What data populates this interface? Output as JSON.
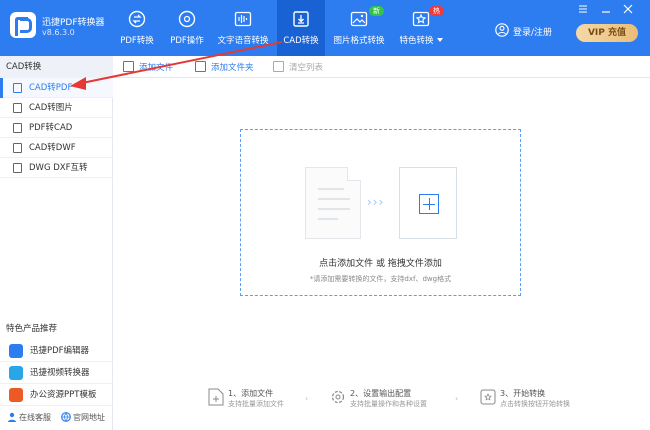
{
  "app": {
    "name": "迅捷PDF转换器",
    "version": "v8.6.3.0"
  },
  "nav": {
    "items": [
      {
        "label": "PDF转换",
        "icon": "pdf-convert-icon"
      },
      {
        "label": "PDF操作",
        "icon": "pdf-operation-icon"
      },
      {
        "label": "文字语音转换",
        "icon": "audio-wave-icon"
      },
      {
        "label": "CAD转换",
        "icon": "cad-download-icon",
        "active": true
      },
      {
        "label": "图片格式转换",
        "icon": "image-icon",
        "badge": "新"
      },
      {
        "label": "特色转换",
        "icon": "star-icon",
        "badge": "热"
      }
    ]
  },
  "account": {
    "login_label": "登录/注册",
    "vip_label": "VIP 充值"
  },
  "sidebar": {
    "header": "CAD转换",
    "items": [
      {
        "label": "CAD转PDF",
        "active": true
      },
      {
        "label": "CAD转图片"
      },
      {
        "label": "PDF转CAD"
      },
      {
        "label": "CAD转DWF"
      },
      {
        "label": "DWG DXF互转"
      }
    ],
    "featured_title": "特色产品推荐",
    "featured": [
      {
        "label": "迅捷PDF编辑器",
        "color": "#2d7df0"
      },
      {
        "label": "迅捷视频转换器",
        "color": "#2aa6e8"
      },
      {
        "label": "办公资源PPT模板",
        "color": "#ee5a24"
      }
    ],
    "links": {
      "support": "在线客服",
      "website": "官网地址"
    }
  },
  "toolbar": {
    "add_file": "添加文件",
    "add_folder": "添加文件夹",
    "clear_list": "清空列表"
  },
  "dropzone": {
    "main_text": "点击添加文件 或 拖拽文件添加",
    "sub_text": "*请添加需要转换的文件，支持dxf、dwg格式"
  },
  "steps": [
    {
      "title": "1、添加文件",
      "sub": "支持批量添加文件"
    },
    {
      "title": "2、设置输出配置",
      "sub": "支持批量操作和各种设置"
    },
    {
      "title": "3、开始转换",
      "sub": "点击转换按钮开始转换"
    }
  ],
  "colors": {
    "brand": "#2d7df0",
    "active_nav": "#1862d3",
    "annotation": "#e53935"
  }
}
